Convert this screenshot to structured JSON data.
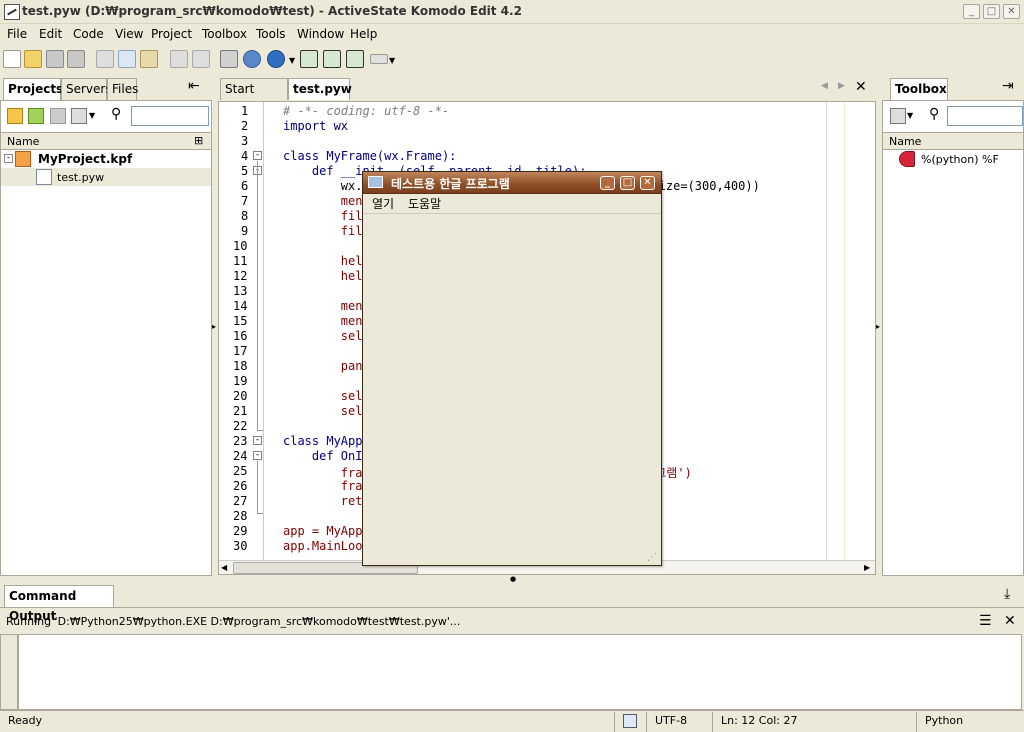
{
  "window": {
    "title": "test.pyw (D:₩program_src₩komodo₩test) - ActiveState Komodo Edit 4.2",
    "min": "_",
    "max": "□",
    "close": "✕"
  },
  "menu": [
    "File",
    "Edit",
    "Code",
    "View",
    "Project",
    "Toolbox",
    "Tools",
    "Window",
    "Help"
  ],
  "left_panel": {
    "tabs": [
      "Projects",
      "Servers",
      "Files"
    ],
    "collapse": "⇤",
    "column": "Name",
    "project": "MyProject.kpf",
    "file": "test.pyw"
  },
  "editor": {
    "tabs": [
      "Start Page",
      "test.pyw"
    ],
    "close": "✕",
    "nav_left": "◀",
    "nav_right": "▶",
    "lines": [
      {
        "n": "1",
        "t": "# -*- coding: utf-8 -*-"
      },
      {
        "n": "2",
        "t": "import wx"
      },
      {
        "n": "3",
        "t": ""
      },
      {
        "n": "4",
        "t": "class MyFrame(wx.Frame):"
      },
      {
        "n": "5",
        "t": "    def __init__(self, parent, id, title):"
      },
      {
        "n": "6",
        "t": "        wx.Frame.__init__(self, parent, id, title, size=(300,400))"
      },
      {
        "n": "7",
        "t": "        menu"
      },
      {
        "n": "8",
        "t": "        file"
      },
      {
        "n": "9",
        "t": "        file"
      },
      {
        "n": "10",
        "t": ""
      },
      {
        "n": "11",
        "t": "        help"
      },
      {
        "n": "12",
        "t": "        help"
      },
      {
        "n": "13",
        "t": ""
      },
      {
        "n": "14",
        "t": "        menu"
      },
      {
        "n": "15",
        "t": "        menu"
      },
      {
        "n": "16",
        "t": "        self"
      },
      {
        "n": "17",
        "t": ""
      },
      {
        "n": "18",
        "t": "        pane"
      },
      {
        "n": "19",
        "t": ""
      },
      {
        "n": "20",
        "t": "        self"
      },
      {
        "n": "21",
        "t": "        self"
      },
      {
        "n": "22",
        "t": ""
      },
      {
        "n": "23",
        "t": "class MyApp"
      },
      {
        "n": "24",
        "t": "    def OnIn"
      },
      {
        "n": "25",
        "t": "        fram                                      로그램')"
      },
      {
        "n": "26",
        "t": "        fram"
      },
      {
        "n": "27",
        "t": "        retu"
      },
      {
        "n": "28",
        "t": ""
      },
      {
        "n": "29",
        "t": "app = MyApp"
      },
      {
        "n": "30",
        "t": "app.MainLoop"
      }
    ]
  },
  "popup": {
    "title": "테스트용 한글 프로그램",
    "menu": [
      "열기",
      "도움말"
    ],
    "min": "_",
    "max": "□",
    "close": "✕"
  },
  "right_panel": {
    "tab": "Toolbox",
    "column": "Name",
    "item": "%(python) %F",
    "pin": "⇥"
  },
  "bottom_panel": {
    "title": "Command Output",
    "running": "Running 'D:₩Python25₩python.EXE D:₩program_src₩komodo₩test₩test.pyw'..."
  },
  "status": {
    "ready": "Ready",
    "encoding": "UTF-8",
    "position": "Ln: 12 Col: 27",
    "language": "Python"
  },
  "colors": {
    "keyword": "#00007f",
    "comment": "#7f7f7f",
    "string": "#7f007f",
    "popup_title": "#8d4f26"
  }
}
